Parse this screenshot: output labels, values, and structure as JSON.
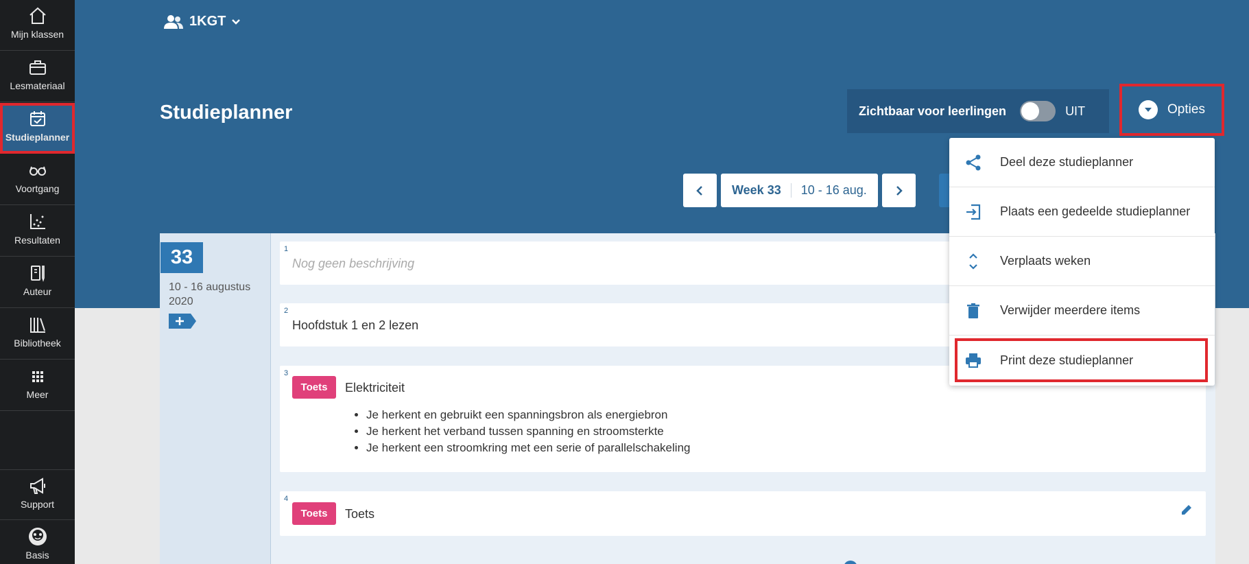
{
  "sidebar": {
    "items": [
      {
        "label": "Mijn klassen",
        "icon": "home-icon"
      },
      {
        "label": "Lesmateriaal",
        "icon": "briefcase-icon"
      },
      {
        "label": "Studieplanner",
        "icon": "calendar-check-icon",
        "active": true
      },
      {
        "label": "Voortgang",
        "icon": "glasses-icon"
      },
      {
        "label": "Resultaten",
        "icon": "scatter-chart-icon"
      },
      {
        "label": "Auteur",
        "icon": "pen-book-icon"
      },
      {
        "label": "Bibliotheek",
        "icon": "books-icon"
      },
      {
        "label": "Meer",
        "icon": "grid-dots-icon"
      }
    ],
    "bottom": [
      {
        "label": "Support",
        "icon": "megaphone-icon"
      },
      {
        "label": "Basis",
        "icon": "avatar-icon"
      }
    ]
  },
  "header": {
    "group": "1KGT",
    "title": "Studieplanner",
    "visibility_label": "Zichtbaar voor leerlingen",
    "visibility_state": "UIT",
    "options_label": "Opties"
  },
  "week_nav": {
    "week_label": "Week 33",
    "date_range": "10 - 16 aug."
  },
  "week": {
    "number": "33",
    "dates": "10 - 16 augustus 2020"
  },
  "items": [
    {
      "num": "1",
      "text": "Nog geen beschrijving",
      "placeholder": true
    },
    {
      "num": "2",
      "text": "Hoofdstuk 1 en 2 lezen"
    },
    {
      "num": "3",
      "tag": "Toets",
      "text": "Elektriciteit",
      "bullets": [
        "Je herkent en gebruikt een spanningsbron als energiebron",
        "Je herkent het verband tussen spanning en stroomsterkte",
        "Je herkent een stroomkring met een serie of parallelschakeling"
      ]
    },
    {
      "num": "4",
      "tag": "Toets",
      "text": "Toets"
    }
  ],
  "menu": {
    "items": [
      {
        "label": "Deel deze studieplanner",
        "icon": "share-icon"
      },
      {
        "label": "Plaats een gedeelde studieplanner",
        "icon": "import-icon"
      },
      {
        "label": "Verplaats weken",
        "icon": "move-vertical-icon"
      },
      {
        "label": "Verwijder meerdere items",
        "icon": "trash-icon"
      },
      {
        "label": "Print deze studieplanner",
        "icon": "printer-icon",
        "highlighted": true
      }
    ]
  },
  "colors": {
    "header": "#2d6592",
    "sidebar": "#1c1e20",
    "accent": "#2f78b3",
    "tag": "#e0407a",
    "highlight": "#e0282e"
  }
}
